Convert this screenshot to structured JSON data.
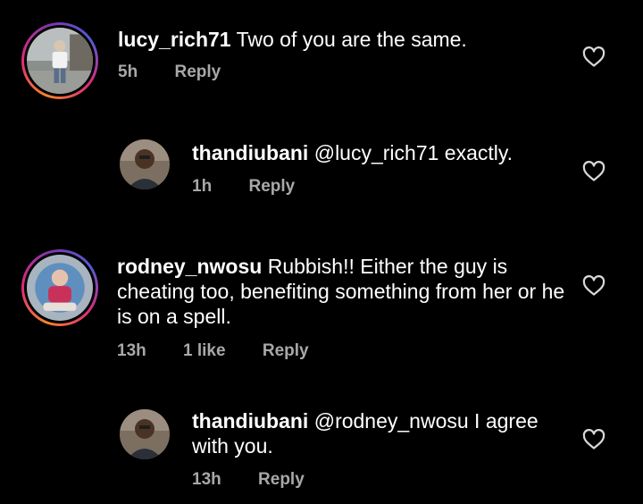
{
  "comments": [
    {
      "username": "lucy_rich71",
      "text": "Two of you are the same.",
      "time": "5h",
      "reply_label": "Reply",
      "avatar_icon": "user-photo-icon"
    },
    {
      "username": "thandiubani",
      "text": "@lucy_rich71 exactly.",
      "time": "1h",
      "reply_label": "Reply",
      "avatar_icon": "user-photo-icon"
    },
    {
      "username": "rodney_nwosu",
      "text": "Rubbish!! Either the guy is cheating too, benefiting something from her or he is on a spell.",
      "time": "13h",
      "likes": "1 like",
      "reply_label": "Reply",
      "avatar_icon": "user-photo-icon"
    },
    {
      "username": "thandiubani",
      "text": "@rodney_nwosu I agree with you.",
      "time": "13h",
      "reply_label": "Reply",
      "avatar_icon": "user-photo-icon"
    }
  ],
  "colors": {
    "background": "#000000",
    "text": "#ffffff",
    "meta": "#a8a8a8",
    "story_ring": [
      "#f58529",
      "#dd2a7b",
      "#8134af",
      "#515bd4"
    ]
  },
  "icons": {
    "like": "heart-outline-icon"
  }
}
